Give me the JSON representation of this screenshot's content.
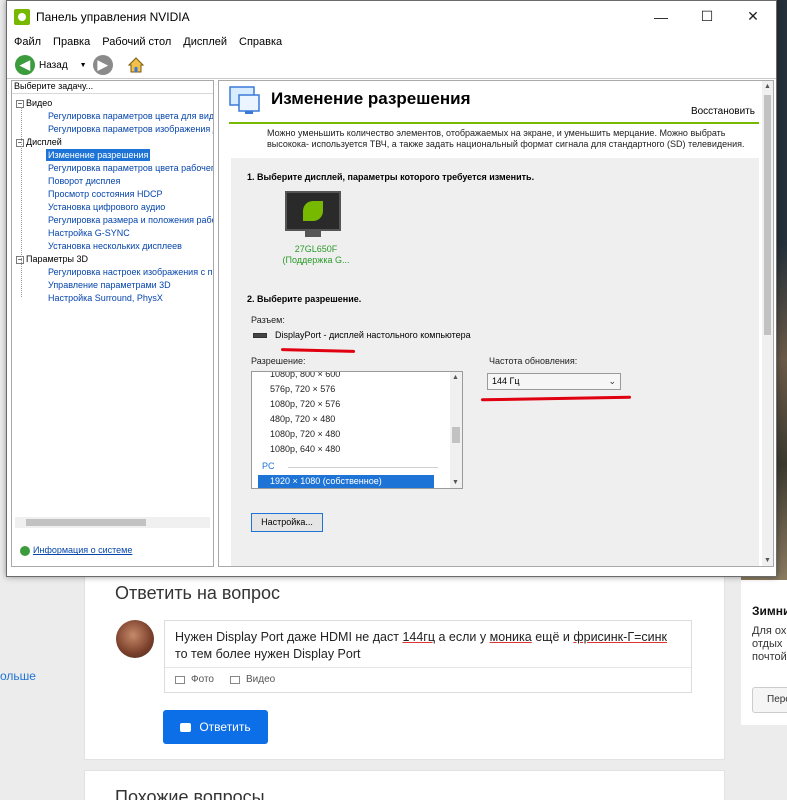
{
  "window": {
    "title": "Панель управления NVIDIA",
    "min": "—",
    "max": "☐",
    "close": "✕"
  },
  "menu": [
    "Файл",
    "Правка",
    "Рабочий стол",
    "Дисплей",
    "Справка"
  ],
  "toolbar": {
    "back_label": "Назад",
    "back_arrow": "◀",
    "forward_arrow": "▶",
    "dropdown": "▼"
  },
  "left_panel": {
    "task_header": "Выберите задачу...",
    "tree": [
      {
        "type": "category",
        "label": "Видео"
      },
      {
        "type": "item",
        "label": "Регулировка параметров цвета для вид"
      },
      {
        "type": "item",
        "label": "Регулировка параметров изображения д"
      },
      {
        "type": "category",
        "label": "Дисплей"
      },
      {
        "type": "item",
        "label": "Изменение разрешения",
        "selected": true
      },
      {
        "type": "item",
        "label": "Регулировка параметров цвета рабочег"
      },
      {
        "type": "item",
        "label": "Поворот дисплея"
      },
      {
        "type": "item",
        "label": "Просмотр состояния HDCP"
      },
      {
        "type": "item",
        "label": "Установка цифрового аудио"
      },
      {
        "type": "item",
        "label": "Регулировка размера и положения рабо"
      },
      {
        "type": "item",
        "label": "Настройка G-SYNC"
      },
      {
        "type": "item",
        "label": "Установка нескольких дисплеев"
      },
      {
        "type": "category",
        "label": "Параметры 3D"
      },
      {
        "type": "item",
        "label": "Регулировка настроек изображения с пр"
      },
      {
        "type": "item",
        "label": "Управление параметрами 3D"
      },
      {
        "type": "item",
        "label": "Настройка Surround, PhysX"
      }
    ],
    "system_info": "Информация о системе"
  },
  "page": {
    "title": "Изменение разрешения",
    "restore": "Восстановить",
    "description": "Можно уменьшить количество элементов, отображаемых на экране, и уменьшить мерцание. Можно выбрать высокока- используется ТВЧ, а также задать национальный формат сигнала для стандартного (SD) телевидения.",
    "step1": "1. Выберите дисплей, параметры которого требуется изменить.",
    "monitor_name": "27GL650F",
    "monitor_sub": "(Поддержка G...",
    "step2": "2. Выберите разрешение.",
    "connector_label": "Разъем:",
    "connector_value": "DisplayPort - дисплей настольного компьютера",
    "resolution_label": "Разрешение:",
    "resolutions": [
      "1080p, 800 × 600",
      "576p, 720 × 576",
      "1080p, 720 × 576",
      "480p, 720 × 480",
      "1080p, 720 × 480",
      "1080p, 640 × 480"
    ],
    "pc_group": "PC",
    "selected_resolution": "1920 × 1080 (собственное)",
    "refresh_label": "Частота обновления:",
    "refresh_value": "144 Гц",
    "customize_button": "Настройка..."
  },
  "forum": {
    "reply_title": "Ответить на вопрос",
    "answer_parts": [
      "Нужен Display Port даже HDMI не даст ",
      "144гц",
      " а если у ",
      "моника",
      " ещё и ",
      "фрисинк-Г=синк",
      " то тем более нужен Display Port"
    ],
    "photo": "Фото",
    "video": "Видео",
    "submit": "Ответить",
    "similar": "Похожие вопросы",
    "left_more": "ольше",
    "side_title": "Зимни",
    "side_lines": [
      "Для ох",
      "отдых",
      "почтой"
    ],
    "side_button": "Пере"
  },
  "colors": {
    "nvidia_green": "#76b900",
    "selection_blue": "#1e74d6",
    "annotation_red": "#e00010",
    "submit_blue": "#0d6fe8"
  }
}
